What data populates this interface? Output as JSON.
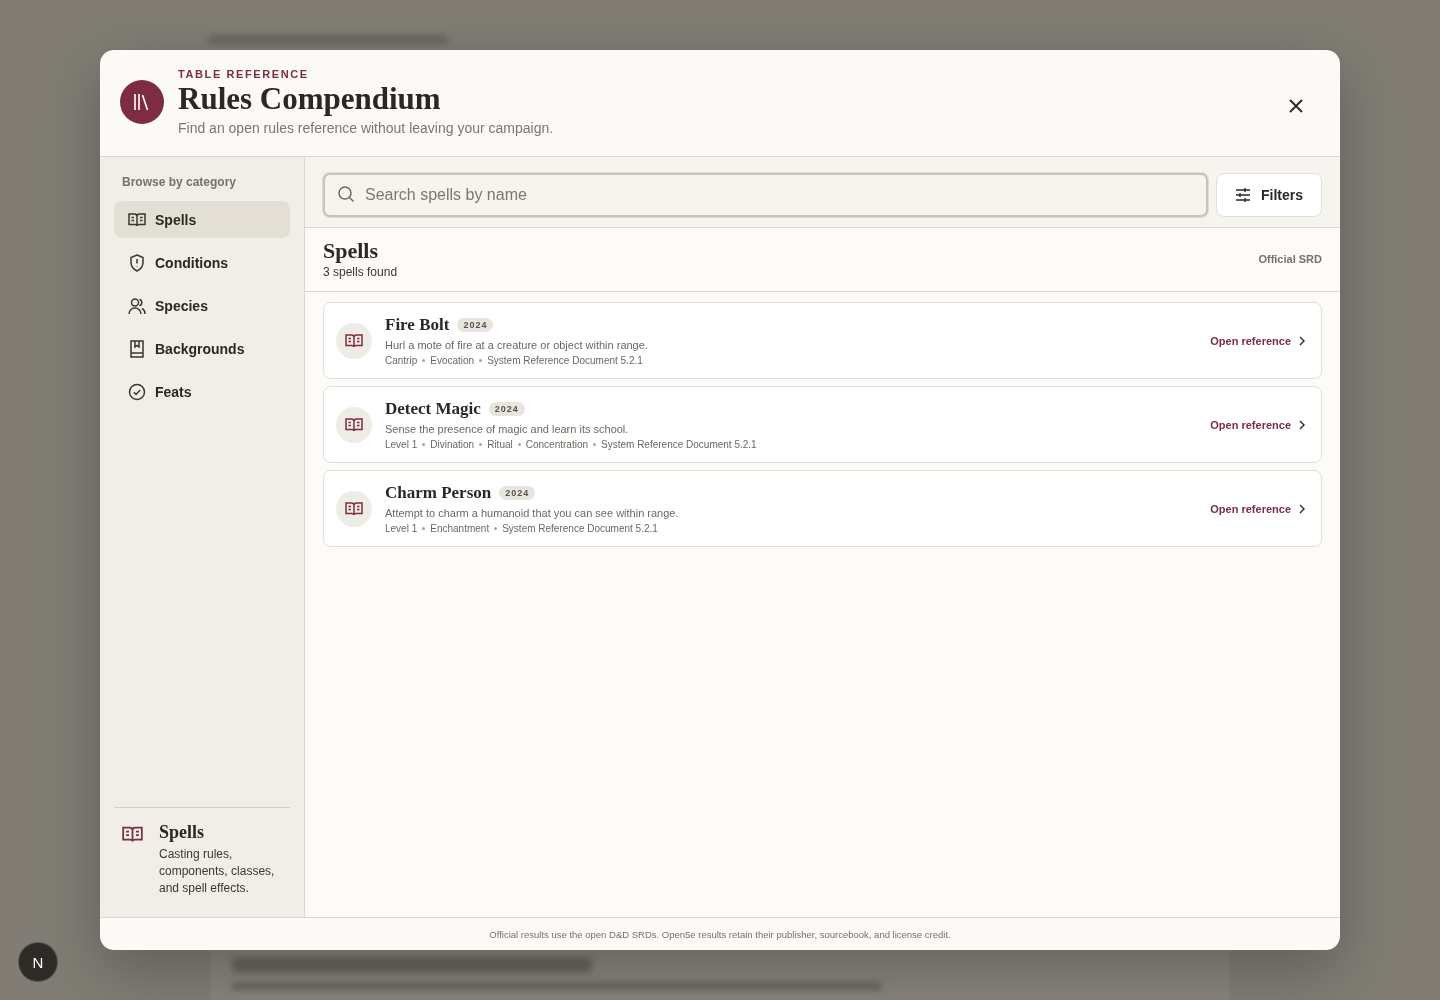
{
  "header": {
    "eyebrow": "TABLE REFERENCE",
    "title": "Rules Compendium",
    "subtitle": "Find an open rules reference without leaving your campaign."
  },
  "sidebar": {
    "heading": "Browse by category",
    "items": [
      {
        "label": "Spells",
        "selected": true
      },
      {
        "label": "Conditions",
        "selected": false
      },
      {
        "label": "Species",
        "selected": false
      },
      {
        "label": "Backgrounds",
        "selected": false
      },
      {
        "label": "Feats",
        "selected": false
      }
    ],
    "info": {
      "title": "Spells",
      "description": "Casting rules, components, classes, and spell effects."
    }
  },
  "search": {
    "placeholder": "Search spells by name"
  },
  "filters_button": "Filters",
  "results": {
    "title": "Spells",
    "count": "3 spells found",
    "source": "Official SRD",
    "items": [
      {
        "name": "Fire Bolt",
        "year": "2024",
        "description": "Hurl a mote of fire at a creature or object within range.",
        "tags": [
          "Cantrip",
          "Evocation",
          "System Reference Document 5.2.1"
        ],
        "action": "Open reference"
      },
      {
        "name": "Detect Magic",
        "year": "2024",
        "description": "Sense the presence of magic and learn its school.",
        "tags": [
          "Level 1",
          "Divination",
          "Ritual",
          "Concentration",
          "System Reference Document 5.2.1"
        ],
        "action": "Open reference"
      },
      {
        "name": "Charm Person",
        "year": "2024",
        "description": "Attempt to charm a humanoid that you can see within range.",
        "tags": [
          "Level 1",
          "Enchantment",
          "System Reference Document 5.2.1"
        ],
        "action": "Open reference"
      }
    ]
  },
  "footer_note": "Official results use the open D&D SRDs. Open5e results retain their publisher, sourcebook, and license credit.",
  "corner_badge": "N"
}
